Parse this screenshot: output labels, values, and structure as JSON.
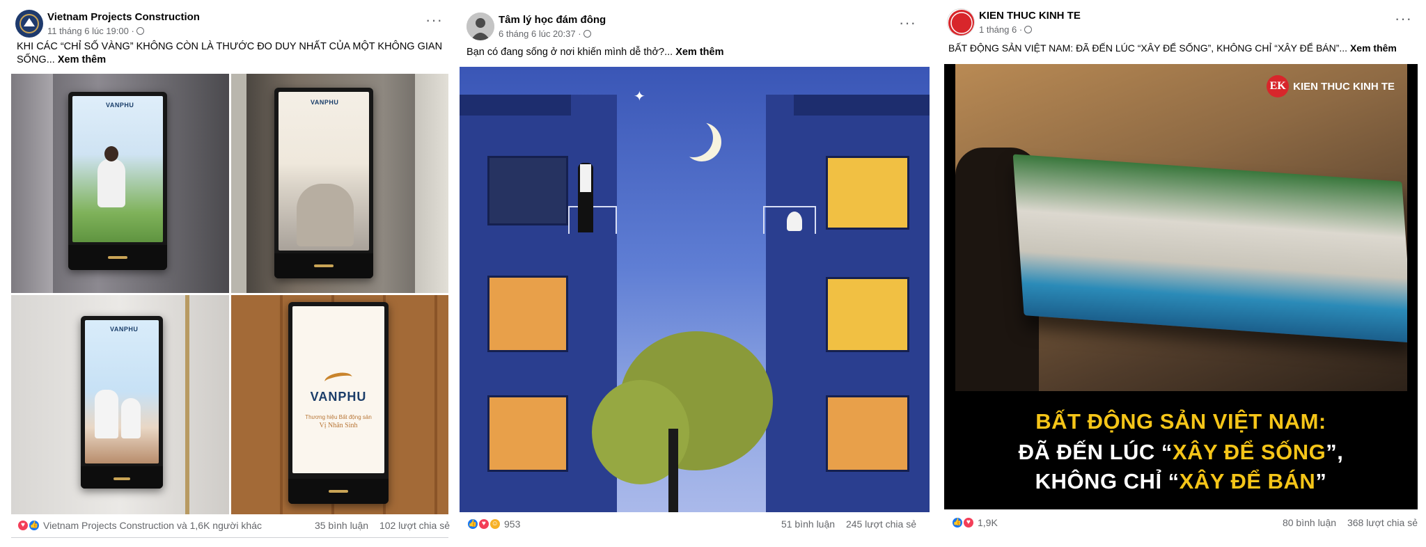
{
  "posts": [
    {
      "author": "Vietnam Projects Construction",
      "time": "11 tháng 6 lúc 19:00 ·",
      "caption": "KHI CÁC “CHỈ SỐ VÀNG” KHÔNG CÒN LÀ THƯỚC ĐO DUY NHẤT CỦA MỘT KHÔNG GIAN SỐNG...",
      "see_more": "Xem thêm",
      "photos": {
        "brand": "VANPHU",
        "tagline_1": "Thương hiệu Bất động sản",
        "tagline_2": "Vị Nhân Sinh"
      },
      "reactions_text": "Vietnam Projects Construction và 1,6K người khác",
      "comments": "35 bình luận",
      "shares": "102 lượt chia sẻ"
    },
    {
      "author": "Tâm lý học đám đông",
      "time": "6 tháng 6 lúc 20:37 ·",
      "caption": "Bạn có đang sống ở nơi khiến mình dễ thở?...",
      "see_more": "Xem thêm",
      "reactions_text": "953",
      "comments": "51 bình luận",
      "shares": "245 lượt chia sẻ"
    },
    {
      "author": "KIEN THUC KINH TE",
      "time": "1 tháng 6 ·",
      "caption": "BẤT ĐỘNG SẢN VIỆT NAM: ĐÃ ĐẾN LÚC “XÂY ĐỂ SỐNG”, KHÔNG CHỈ “XÂY ĐỂ BÁN”...",
      "see_more": "Xem thêm",
      "video": {
        "logo_mark": "EK",
        "logo_text": "KIEN THUC KINH TE",
        "line1": "BẤT ĐỘNG SẢN VIỆT NAM:",
        "line2_a": "ĐÃ ĐẾN LÚC “",
        "line2_b": "XÂY ĐỂ SỐNG",
        "line2_c": "”,",
        "line3_a": "KHÔNG CHỈ “",
        "line3_b": "XÂY ĐỂ BÁN",
        "line3_c": "”"
      },
      "reactions_text": "1,9K",
      "comments": "80 bình luận",
      "shares": "368 lượt chia sẻ"
    }
  ],
  "icons": {
    "more": "more-options-icon",
    "audience": "globe-icon",
    "like": "like-reaction-icon",
    "love": "love-reaction-icon",
    "haha": "haha-reaction-icon"
  },
  "colors": {
    "text_primary": "#050505",
    "text_secondary": "#65676b",
    "like": "#1877f2",
    "love": "#f33e58",
    "haha": "#f7b125",
    "video_highlight": "#f5c518"
  }
}
